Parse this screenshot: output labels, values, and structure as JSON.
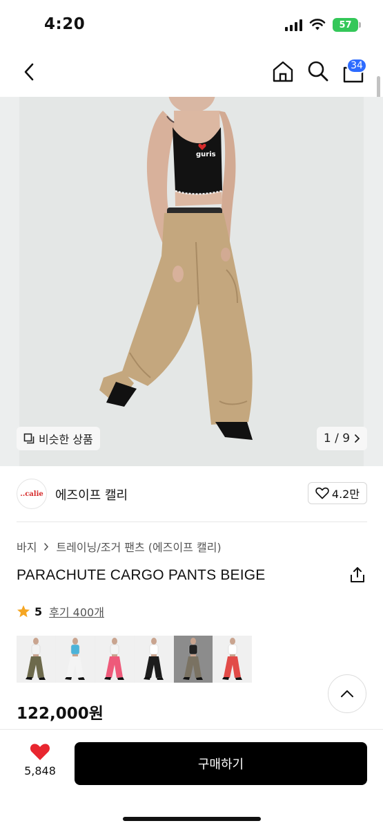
{
  "status_bar": {
    "time": "4:20",
    "battery": "57"
  },
  "nav": {
    "cart_count": "34"
  },
  "gallery": {
    "similar_label": "비슷한 상품",
    "counter": "1 / 9"
  },
  "brand": {
    "logo_text": "..calie",
    "name": "에즈이프 캘리",
    "likes": "4.2만"
  },
  "breadcrumb": [
    "바지",
    "트레이닝/조거 팬츠 (에즈이프 캘리)"
  ],
  "product": {
    "title": "PARACHUTE CARGO PANTS BEIGE",
    "rating": "5",
    "review_label": "후기 400개",
    "price": "122,000원"
  },
  "thumbnails": [
    {
      "top": "#f2f2f2",
      "pants": "#6d6a4c"
    },
    {
      "top": "#4cb3d9",
      "pants": "#f4f4f4"
    },
    {
      "top": "#f4f4f4",
      "pants": "#ee5a7a"
    },
    {
      "top": "#ffffff",
      "pants": "#1c1c1c"
    },
    {
      "top": "#222222",
      "pants": "#7a7262"
    },
    {
      "top": "#ffffff",
      "pants": "#e24b48"
    }
  ],
  "bottom": {
    "wish_count": "5,848",
    "buy_label": "구매하기"
  },
  "colors": {
    "accent": "#2d6bff",
    "heart": "#e8262f",
    "star": "#f5a623",
    "battery": "#34c759"
  }
}
